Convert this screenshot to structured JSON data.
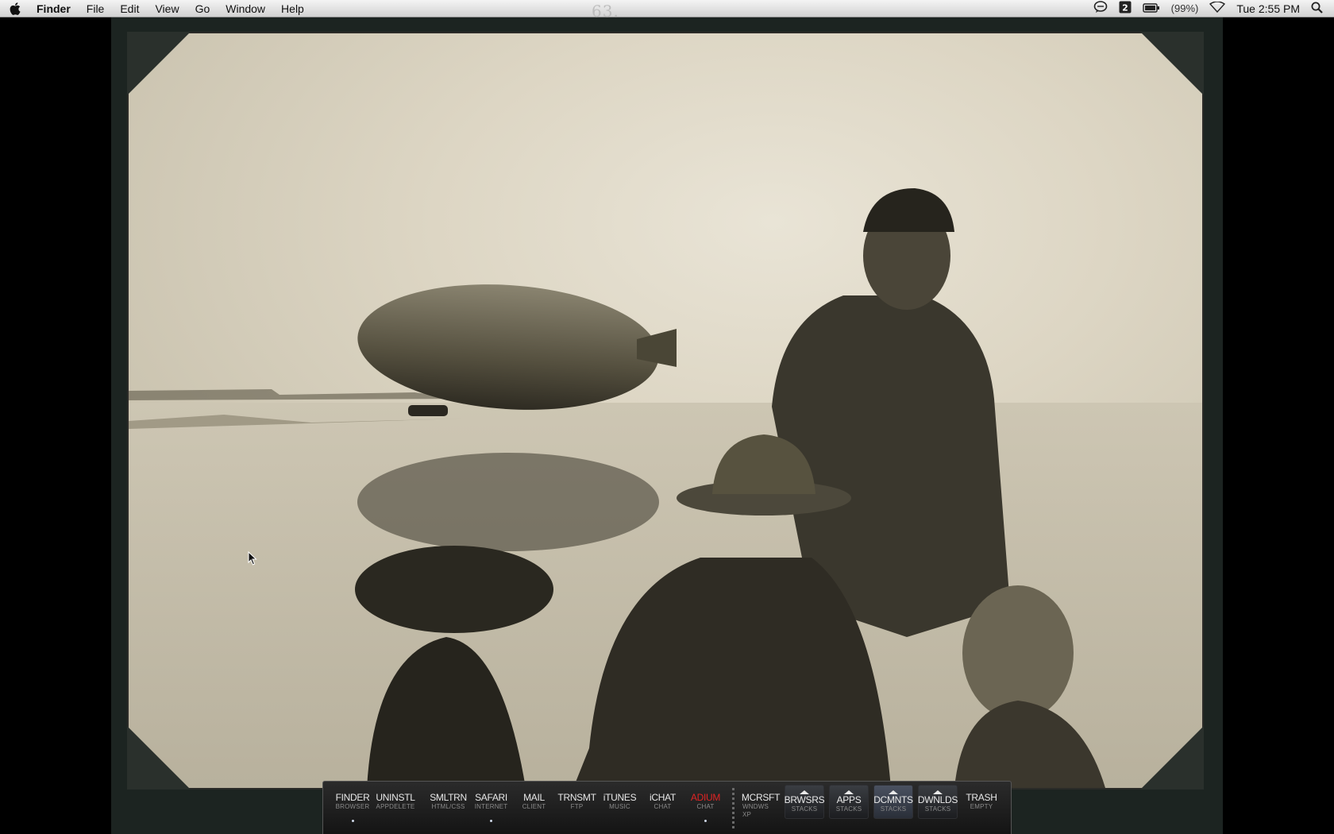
{
  "menubar": {
    "app_name": "Finder",
    "menus": [
      "File",
      "Edit",
      "View",
      "Go",
      "Window",
      "Help"
    ],
    "battery_percent": "(99%)",
    "clock": "Tue 2:55 PM",
    "photo_label": "63."
  },
  "dock": {
    "group1": [
      {
        "label": "FINDER",
        "sub": "BROWSER",
        "running": true
      },
      {
        "label": "UNINSTL",
        "sub": "APPDELETE",
        "running": false
      }
    ],
    "group2": [
      {
        "label": "SMLTRN",
        "sub": "HTML/CSS",
        "running": false
      },
      {
        "label": "SAFARI",
        "sub": "INTERNET",
        "running": true
      },
      {
        "label": "MAIL",
        "sub": "CLIENT",
        "running": false
      },
      {
        "label": "TRNSMT",
        "sub": "FTP",
        "running": false
      },
      {
        "label": "iTUNES",
        "sub": "MUSIC",
        "running": false
      },
      {
        "label": "iCHAT",
        "sub": "CHAT",
        "running": false
      },
      {
        "label": "ADIUM",
        "sub": "CHAT",
        "running": true,
        "alert": true
      }
    ],
    "group3": [
      {
        "label": "MCRSFT",
        "sub": "WNDWS XP"
      }
    ],
    "stacks": [
      {
        "label": "BRWSRS",
        "sub": "STACKS"
      },
      {
        "label": "APPS",
        "sub": "STACKS"
      },
      {
        "label": "DCMNTS",
        "sub": "STACKS",
        "active": true
      },
      {
        "label": "DWNLDS",
        "sub": "STACKS"
      }
    ],
    "trash": {
      "label": "TRASH",
      "sub": "EMPTY"
    }
  },
  "colors": {
    "alert_red": "#e02424",
    "menubar": "#e6e6e6",
    "dock_bg": "#1e1e1e"
  }
}
